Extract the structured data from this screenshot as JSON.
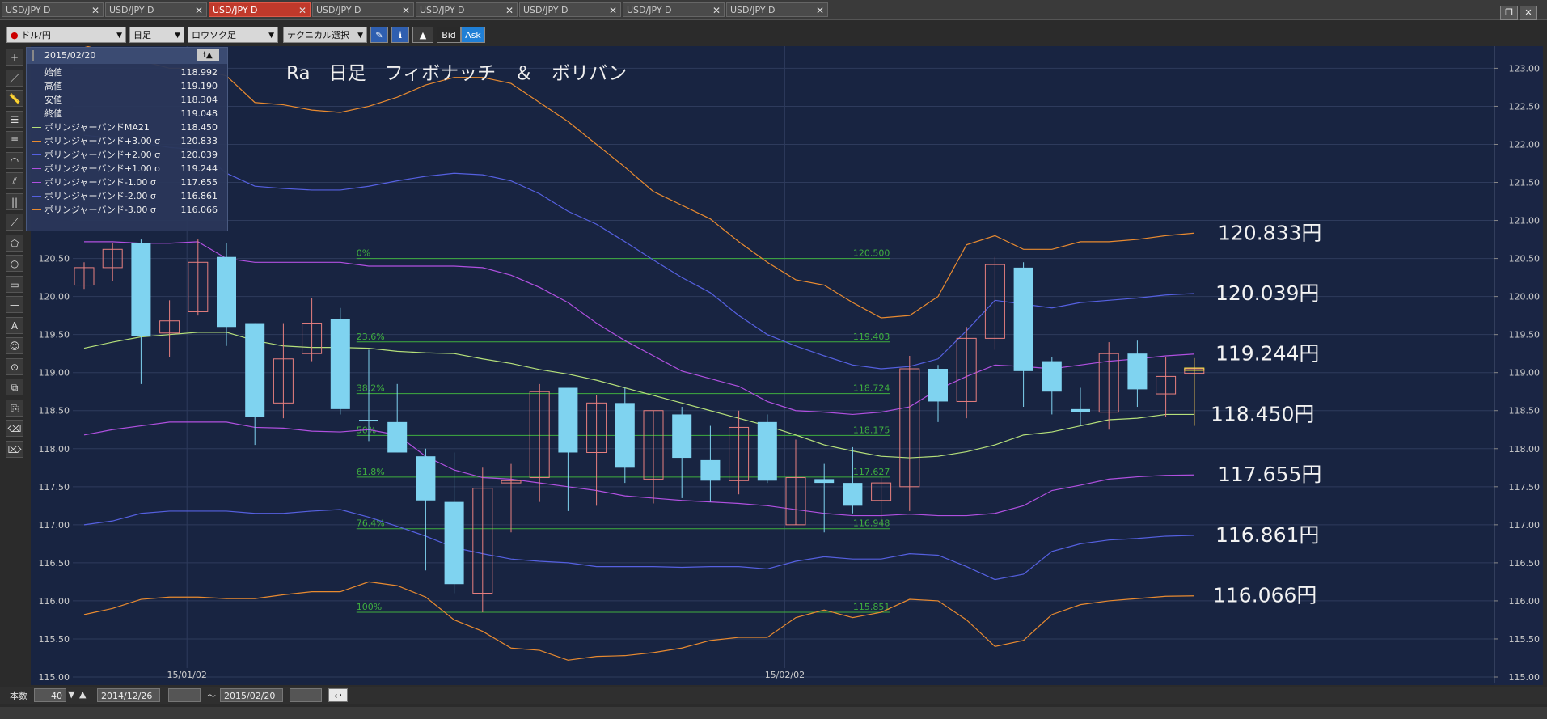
{
  "tabs": [
    "USD/JPY D",
    "USD/JPY D",
    "USD/JPY D",
    "USD/JPY D",
    "USD/JPY D",
    "USD/JPY D",
    "USD/JPY D",
    "USD/JPY D"
  ],
  "active_tab": 2,
  "toolbar": {
    "pair": "ドル/円",
    "timeframe": "日足",
    "chart_type": "ロウソク足",
    "technical": "テクニカル選択",
    "bid": "Bid",
    "ask": "Ask"
  },
  "chart_title": "Ra　日足　フィボナッチ　＆　ボリバン",
  "info_panel": {
    "date": "2015/02/20",
    "rows": [
      {
        "label": "始値",
        "value": "118.992",
        "color": ""
      },
      {
        "label": "高値",
        "value": "119.190",
        "color": ""
      },
      {
        "label": "安値",
        "value": "118.304",
        "color": ""
      },
      {
        "label": "終値",
        "value": "119.048",
        "color": ""
      },
      {
        "label": "ボリンジャーバンドMA21",
        "value": "118.450",
        "color": "#b5e07a"
      },
      {
        "label": "ボリンジャーバンド+3.00 σ",
        "value": "120.833",
        "color": "#e88a30"
      },
      {
        "label": "ボリンジャーバンド+2.00 σ",
        "value": "120.039",
        "color": "#5560e0"
      },
      {
        "label": "ボリンジャーバンド+1.00 σ",
        "value": "119.244",
        "color": "#b050e0"
      },
      {
        "label": "ボリンジャーバンド-1.00 σ",
        "value": "117.655",
        "color": "#b050e0"
      },
      {
        "label": "ボリンジャーバンド-2.00 σ",
        "value": "116.861",
        "color": "#5560e0"
      },
      {
        "label": "ボリンジャーバンド-3.00 σ",
        "value": "116.066",
        "color": "#e88a30"
      }
    ]
  },
  "band_labels": [
    "120.833円",
    "120.039円",
    "119.244円",
    "118.450円",
    "117.655円",
    "116.861円",
    "116.066円"
  ],
  "bottom": {
    "count_label": "本数",
    "count": "40",
    "from": "2014/12/26",
    "tilde": "〜",
    "to": "2015/02/20"
  },
  "chart_data": {
    "type": "candlestick",
    "title": "Ra　日足　フィボナッチ　＆　ボリバン",
    "ylim": [
      115.0,
      123.1
    ],
    "y_ticks": [
      "123.00",
      "122.50",
      "122.00",
      "121.50",
      "121.00",
      "120.50",
      "120.00",
      "119.50",
      "119.00",
      "118.50",
      "118.00",
      "117.50",
      "117.00",
      "116.50",
      "116.00",
      "115.50",
      "115.00"
    ],
    "x_ticks": [
      {
        "label": "15/01/02",
        "index": 4
      },
      {
        "label": "15/02/02",
        "index": 25
      }
    ],
    "candles": [
      {
        "o": 120.15,
        "h": 120.45,
        "l": 120.1,
        "c": 120.38
      },
      {
        "o": 120.38,
        "h": 120.7,
        "l": 120.2,
        "c": 120.62
      },
      {
        "o": 120.7,
        "h": 120.75,
        "l": 118.85,
        "c": 119.48
      },
      {
        "o": 119.52,
        "h": 119.95,
        "l": 119.2,
        "c": 119.68
      },
      {
        "o": 119.8,
        "h": 120.75,
        "l": 119.75,
        "c": 120.45
      },
      {
        "o": 120.52,
        "h": 120.7,
        "l": 119.35,
        "c": 119.6
      },
      {
        "o": 119.65,
        "h": 119.65,
        "l": 118.05,
        "c": 118.42
      },
      {
        "o": 118.6,
        "h": 119.65,
        "l": 118.4,
        "c": 119.18
      },
      {
        "o": 119.25,
        "h": 119.98,
        "l": 119.15,
        "c": 119.65
      },
      {
        "o": 119.7,
        "h": 119.85,
        "l": 118.45,
        "c": 118.52
      },
      {
        "o": 118.38,
        "h": 119.3,
        "l": 118.1,
        "c": 118.36
      },
      {
        "o": 118.35,
        "h": 118.85,
        "l": 117.95,
        "c": 117.95
      },
      {
        "o": 117.9,
        "h": 118.0,
        "l": 116.4,
        "c": 117.32
      },
      {
        "o": 117.3,
        "h": 117.95,
        "l": 116.1,
        "c": 116.22
      },
      {
        "o": 116.1,
        "h": 117.75,
        "l": 115.85,
        "c": 117.48
      },
      {
        "o": 117.55,
        "h": 117.8,
        "l": 116.9,
        "c": 117.58
      },
      {
        "o": 117.62,
        "h": 118.85,
        "l": 117.3,
        "c": 118.75
      },
      {
        "o": 118.8,
        "h": 118.8,
        "l": 117.18,
        "c": 117.95
      },
      {
        "o": 117.95,
        "h": 118.7,
        "l": 117.25,
        "c": 118.6
      },
      {
        "o": 118.6,
        "h": 118.8,
        "l": 117.55,
        "c": 117.75
      },
      {
        "o": 117.6,
        "h": 118.5,
        "l": 117.28,
        "c": 118.5
      },
      {
        "o": 118.45,
        "h": 118.55,
        "l": 117.35,
        "c": 117.88
      },
      {
        "o": 117.85,
        "h": 118.3,
        "l": 117.3,
        "c": 117.58
      },
      {
        "o": 117.58,
        "h": 118.5,
        "l": 117.4,
        "c": 118.28
      },
      {
        "o": 118.35,
        "h": 118.45,
        "l": 117.55,
        "c": 117.58
      },
      {
        "o": 117.0,
        "h": 118.12,
        "l": 117.0,
        "c": 117.62
      },
      {
        "o": 117.6,
        "h": 117.8,
        "l": 116.9,
        "c": 117.55
      },
      {
        "o": 117.55,
        "h": 118.02,
        "l": 117.15,
        "c": 117.25
      },
      {
        "o": 117.32,
        "h": 117.62,
        "l": 117.0,
        "c": 117.55
      },
      {
        "o": 117.5,
        "h": 119.22,
        "l": 117.18,
        "c": 119.05
      },
      {
        "o": 119.05,
        "h": 119.1,
        "l": 118.35,
        "c": 118.62
      },
      {
        "o": 118.62,
        "h": 119.6,
        "l": 118.4,
        "c": 119.45
      },
      {
        "o": 119.45,
        "h": 120.52,
        "l": 119.3,
        "c": 120.42
      },
      {
        "o": 120.38,
        "h": 120.45,
        "l": 118.55,
        "c": 119.02
      },
      {
        "o": 119.15,
        "h": 119.2,
        "l": 118.45,
        "c": 118.75
      },
      {
        "o": 118.52,
        "h": 118.8,
        "l": 118.3,
        "c": 118.48
      },
      {
        "o": 118.48,
        "h": 119.4,
        "l": 118.25,
        "c": 119.25
      },
      {
        "o": 119.25,
        "h": 119.42,
        "l": 118.55,
        "c": 118.78
      },
      {
        "o": 118.72,
        "h": 119.2,
        "l": 118.42,
        "c": 118.95
      },
      {
        "o": 118.99,
        "h": 119.19,
        "l": 118.3,
        "c": 119.05
      }
    ],
    "bollinger": {
      "ma21": [
        119.32,
        119.4,
        119.47,
        119.5,
        119.53,
        119.53,
        119.42,
        119.35,
        119.33,
        119.33,
        119.32,
        119.28,
        119.26,
        119.25,
        119.18,
        119.12,
        119.04,
        118.98,
        118.9,
        118.8,
        118.7,
        118.6,
        118.5,
        118.4,
        118.3,
        118.18,
        118.05,
        117.97,
        117.9,
        117.88,
        117.9,
        117.96,
        118.05,
        118.18,
        118.22,
        118.3,
        118.38,
        118.4,
        118.45,
        118.45
      ],
      "p3": [
        123.3,
        123.2,
        123.1,
        123.0,
        123.0,
        122.9,
        122.55,
        122.52,
        122.45,
        122.42,
        122.5,
        122.62,
        122.78,
        122.88,
        122.88,
        122.8,
        122.55,
        122.3,
        122.0,
        121.7,
        121.38,
        121.2,
        121.02,
        120.72,
        120.45,
        120.22,
        120.15,
        119.92,
        119.72,
        119.75,
        120.0,
        120.68,
        120.8,
        120.62,
        120.62,
        120.72,
        120.72,
        120.75,
        120.8,
        120.833
      ],
      "p2": [
        122.12,
        122.08,
        122.02,
        121.96,
        121.93,
        121.62,
        121.45,
        121.42,
        121.4,
        121.4,
        121.45,
        121.52,
        121.58,
        121.62,
        121.6,
        121.52,
        121.35,
        121.12,
        120.95,
        120.72,
        120.48,
        120.25,
        120.05,
        119.75,
        119.5,
        119.35,
        119.22,
        119.1,
        119.05,
        119.08,
        119.18,
        119.55,
        119.95,
        119.9,
        119.85,
        119.92,
        119.95,
        119.98,
        120.02,
        120.039
      ],
      "p1": [
        120.72,
        120.72,
        120.7,
        120.7,
        120.72,
        120.5,
        120.45,
        120.45,
        120.45,
        120.45,
        120.4,
        120.4,
        120.4,
        120.4,
        120.38,
        120.28,
        120.12,
        119.92,
        119.65,
        119.42,
        119.22,
        119.02,
        118.92,
        118.82,
        118.62,
        118.5,
        118.48,
        118.45,
        118.48,
        118.55,
        118.78,
        118.95,
        119.1,
        119.08,
        119.05,
        119.1,
        119.15,
        119.18,
        119.22,
        119.244
      ],
      "m1": [
        118.18,
        118.25,
        118.3,
        118.35,
        118.35,
        118.35,
        118.28,
        118.27,
        118.23,
        118.22,
        118.25,
        118.18,
        117.9,
        117.72,
        117.62,
        117.6,
        117.55,
        117.5,
        117.45,
        117.38,
        117.35,
        117.32,
        117.3,
        117.28,
        117.25,
        117.2,
        117.15,
        117.12,
        117.12,
        117.14,
        117.12,
        117.12,
        117.15,
        117.25,
        117.45,
        117.52,
        117.6,
        117.63,
        117.65,
        117.655
      ],
      "m2": [
        117.0,
        117.05,
        117.15,
        117.18,
        117.18,
        117.18,
        117.15,
        117.15,
        117.18,
        117.2,
        117.1,
        116.98,
        116.85,
        116.7,
        116.62,
        116.55,
        116.52,
        116.5,
        116.45,
        116.45,
        116.45,
        116.44,
        116.45,
        116.45,
        116.42,
        116.52,
        116.58,
        116.55,
        116.55,
        116.62,
        116.6,
        116.45,
        116.28,
        116.35,
        116.65,
        116.75,
        116.8,
        116.82,
        116.85,
        116.861
      ],
      "m3": [
        115.82,
        115.9,
        116.02,
        116.05,
        116.05,
        116.03,
        116.03,
        116.08,
        116.12,
        116.12,
        116.25,
        116.2,
        116.05,
        115.75,
        115.6,
        115.38,
        115.35,
        115.22,
        115.27,
        115.28,
        115.32,
        115.38,
        115.48,
        115.52,
        115.52,
        115.78,
        115.88,
        115.78,
        115.85,
        116.02,
        116.0,
        115.75,
        115.4,
        115.48,
        115.82,
        115.95,
        116.0,
        116.03,
        116.06,
        116.066
      ]
    },
    "fibonacci": [
      {
        "label": "0%",
        "value": "120.500"
      },
      {
        "label": "23.6%",
        "value": "119.403"
      },
      {
        "label": "38.2%",
        "value": "118.724"
      },
      {
        "label": "50%",
        "value": "118.175"
      },
      {
        "label": "61.8%",
        "value": "117.627"
      },
      {
        "label": "76.4%",
        "value": "116.948"
      },
      {
        "label": "100%",
        "value": "115.851"
      }
    ],
    "colors": {
      "background": "#182441",
      "up": "#e87f7f",
      "down": "#7fd3f0",
      "ma21": "#b5e07a",
      "s3": "#e88a30",
      "s2": "#5560e0",
      "s1": "#b050e0",
      "fib": "#3fae3f",
      "grid": "#2e3b5c"
    }
  }
}
